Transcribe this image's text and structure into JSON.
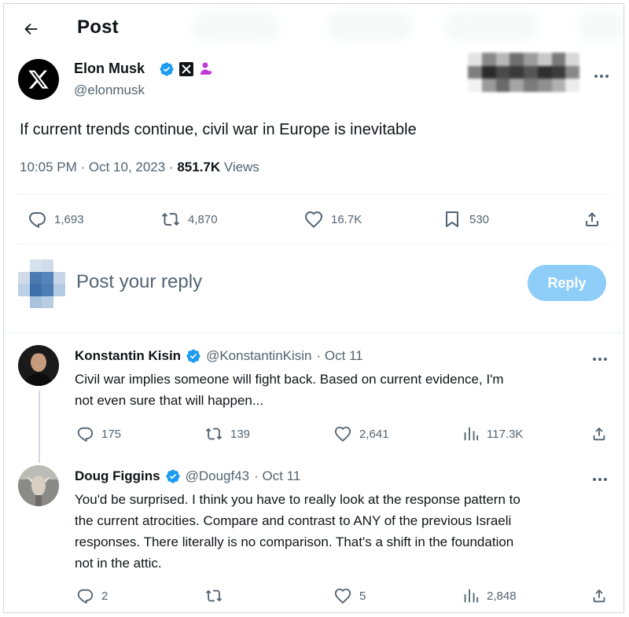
{
  "header": {
    "title": "Post"
  },
  "post": {
    "author_name": "Elon Musk",
    "author_handle": "@elonmusk",
    "text": "If current trends continue, civil war in Europe is inevitable",
    "time": "10:05 PM · Oct 10, 2023 · ",
    "views_count": "851.7K",
    "views_label": " Views",
    "stats": {
      "replies": "1,693",
      "reposts": "4,870",
      "likes": "16.7K",
      "bookmarks": "530"
    }
  },
  "composer": {
    "placeholder": "Post your reply",
    "button_label": "Reply"
  },
  "replies": [
    {
      "name": "Konstantin Kisin",
      "handle": "@KonstantinKisin",
      "date": "· Oct 11",
      "lines": [
        "Civil war implies someone will fight back. Based on current evidence, I'm",
        "not even sure that will happen..."
      ],
      "stats": {
        "replies": "175",
        "reposts": "139",
        "likes": "2,641",
        "views": "117.3K"
      }
    },
    {
      "name": "Doug Figgins",
      "handle": "@Dougf43",
      "date": "· Oct 11",
      "lines": [
        "You'd be surprised. I think you have to really look at the response pattern to",
        "the current atrocities. Compare and contrast to ANY of the previous Israeli",
        "responses. There literally is no comparison. That's a shift in the foundation",
        "not in the attic."
      ],
      "stats": {
        "replies": "2",
        "reposts": "",
        "likes": "5",
        "views": "2,848"
      }
    }
  ],
  "colors": {
    "accent": "#1d9bf0",
    "verified": "#1d9bf0",
    "reply_button": "#8ecdf8",
    "text_secondary": "#536471"
  },
  "icons": [
    "back-arrow-icon",
    "x-logo-icon",
    "verified-badge-icon",
    "x-affiliate-icon",
    "user-affiliate-icon",
    "more-icon",
    "reply-icon",
    "repost-icon",
    "like-icon",
    "bookmark-icon",
    "share-icon",
    "views-icon"
  ]
}
